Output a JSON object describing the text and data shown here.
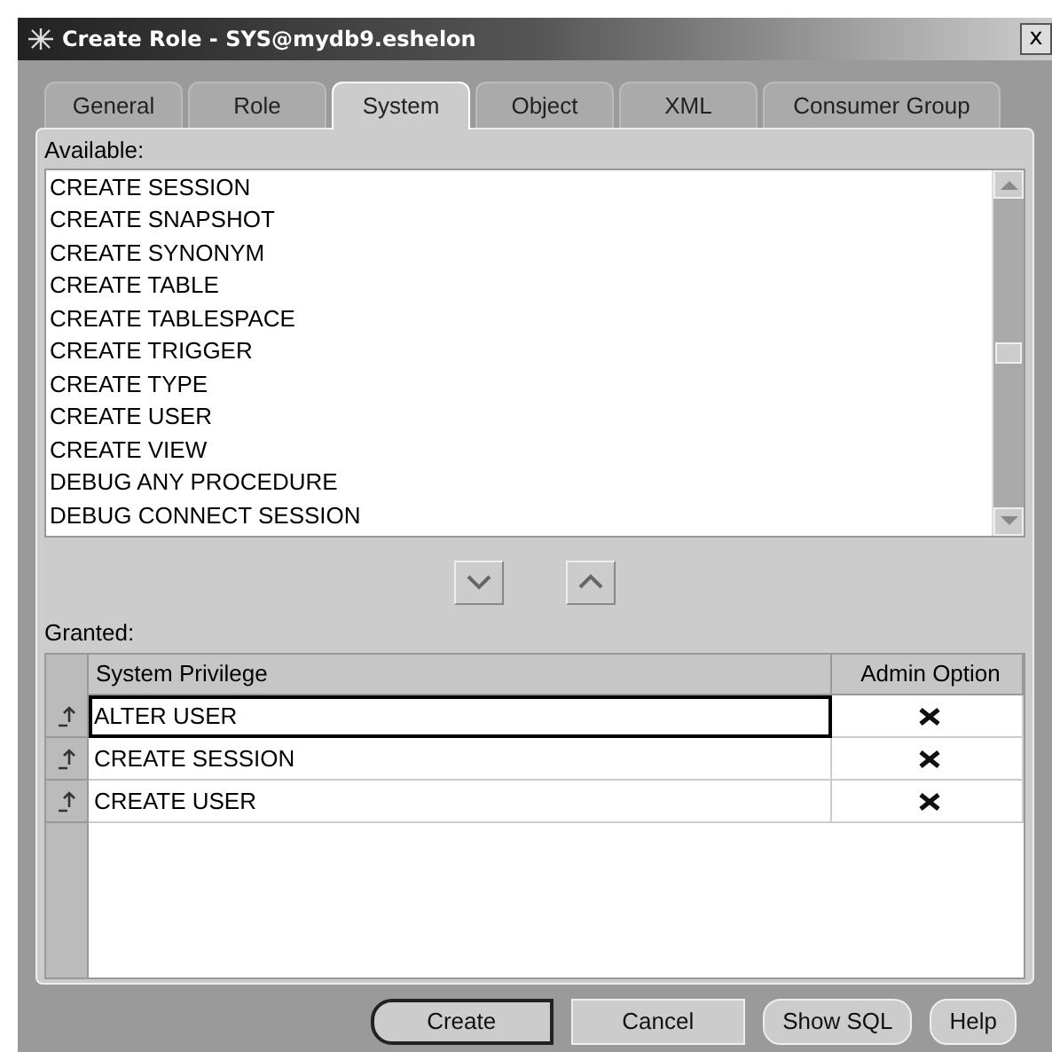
{
  "window": {
    "title": "Create Role - SYS@mydb9.eshelon",
    "close": "x"
  },
  "tabs": [
    {
      "label": "General",
      "selected": false
    },
    {
      "label": "Role",
      "selected": false
    },
    {
      "label": "System",
      "selected": true
    },
    {
      "label": "Object",
      "selected": false
    },
    {
      "label": "XML",
      "selected": false
    },
    {
      "label": "Consumer Group",
      "selected": false
    }
  ],
  "available": {
    "label": "Available:",
    "items": [
      "CREATE SESSION",
      "CREATE SNAPSHOT",
      "CREATE SYNONYM",
      "CREATE TABLE",
      "CREATE TABLESPACE",
      "CREATE TRIGGER",
      "CREATE TYPE",
      "CREATE USER",
      "CREATE VIEW",
      "DEBUG ANY PROCEDURE",
      "DEBUG CONNECT SESSION"
    ]
  },
  "granted": {
    "label": "Granted:",
    "columns": [
      "System Privilege",
      "Admin Option"
    ],
    "rows": [
      {
        "privilege": "ALTER USER",
        "admin_option": true,
        "selected": true
      },
      {
        "privilege": "CREATE SESSION",
        "admin_option": true,
        "selected": false
      },
      {
        "privilege": "CREATE USER",
        "admin_option": true,
        "selected": false
      }
    ]
  },
  "buttons": [
    {
      "label": "Create",
      "kind": "default"
    },
    {
      "label": "Cancel",
      "kind": "square"
    },
    {
      "label": "Show SQL",
      "kind": "round"
    },
    {
      "label": "Help",
      "kind": "round"
    }
  ]
}
